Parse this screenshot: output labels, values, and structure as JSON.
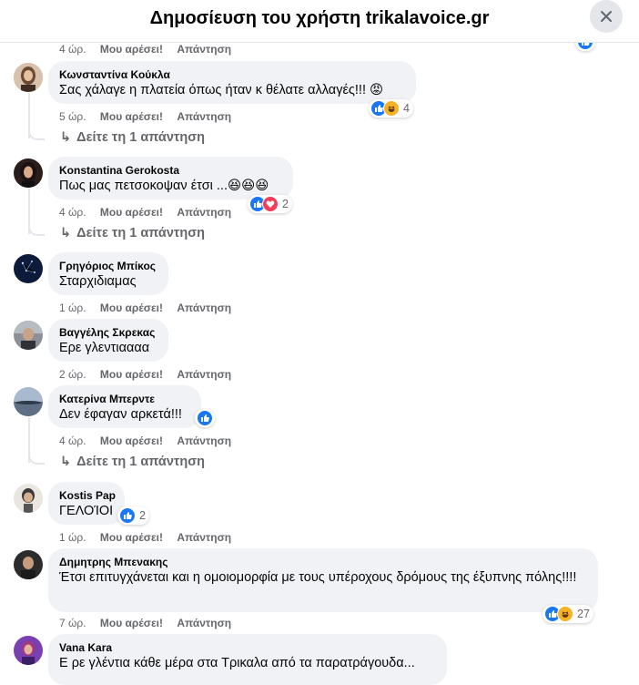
{
  "header": {
    "title": "Δημοσίευση του χρήστη trikalavoice.gr"
  },
  "colors": {
    "like": "#1877f2",
    "love": "#f33e58",
    "haha": "#f7b125",
    "angry": "#e9710f",
    "meta": "#65676b",
    "bubble": "#f0f2f5"
  },
  "labels": {
    "like": "Μου αρέσει!",
    "reply": "Απάντηση"
  },
  "top_meta": {
    "time": "4 ώρ."
  },
  "comments": [
    {
      "author": "Κωνσταντίνα Κούκλα",
      "text": "Σας χάλαγε η πλατεία όπως ήταν κ θέλατε αλλαγές!!! 😡",
      "time": "5 ώρ.",
      "reactions": [
        "like-icon",
        "haha-icon"
      ],
      "reaction_count": "4",
      "view_replies": "Δείτε τη 1 απάντηση"
    },
    {
      "author": "Konstantina Gerokosta",
      "text": "Πως μας πετσοκοψαν έτσι ...😆😆😆",
      "time": "4 ώρ.",
      "reactions": [
        "like-icon",
        "love-icon"
      ],
      "reaction_count": "2",
      "view_replies": "Δείτε τη 1 απάντηση"
    },
    {
      "author": "Γρηγόριος Μπίκος",
      "text": "Σταρχιδιαμας",
      "time": "1 ώρ."
    },
    {
      "author": "Βαγγέλης Σκρεκας",
      "text": "Ερε γλεντιαααα",
      "time": "2 ώρ."
    },
    {
      "author": "Κατερίνα Μπερντε",
      "text": "Δεν έφαγαν αρκετά!!!",
      "time": "4 ώρ.",
      "reactions": [
        "like-icon"
      ],
      "reaction_count": "",
      "view_replies": "Δείτε τη 1 απάντηση"
    },
    {
      "author": "Kostis Pap",
      "text": "ΓΕΛΟΊΟΙ",
      "time": "1 ώρ.",
      "reactions": [
        "like-icon"
      ],
      "reaction_count": "2"
    },
    {
      "author": "Δημητρης Μπενακης",
      "text": "Έτσι επιτυγχάνεται και η ομοιομορφία με τους υπέροχους δρόμους της έξυπνης πόλης!!!!",
      "time": "7 ώρ.",
      "reactions": [
        "like-icon",
        "haha-icon"
      ],
      "reaction_count": "27"
    },
    {
      "author": "Vana Kara",
      "text": "Ε ρε γλέντια κάθε μέρα στα Τρικαλα από τα παρατράγουδα..."
    }
  ]
}
